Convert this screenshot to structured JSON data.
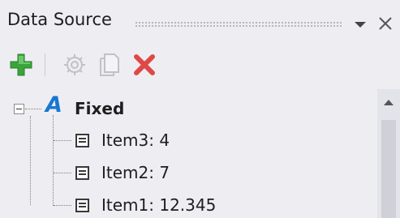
{
  "panel": {
    "title": "Data Source"
  },
  "toolbar": {
    "buttons": [
      {
        "icon": "plus-icon",
        "enabled": true,
        "color": "#3aa53a"
      },
      {
        "icon": "gear-icon",
        "enabled": false
      },
      {
        "icon": "copy-icon",
        "enabled": false
      },
      {
        "icon": "delete-icon",
        "enabled": true,
        "color": "#e04848"
      }
    ]
  },
  "tree": {
    "root": {
      "icon_glyph": "A",
      "label": "Fixed",
      "expanded": true
    },
    "items": [
      {
        "label": "Item3: 4"
      },
      {
        "label": "Item2: 7"
      },
      {
        "label": "Item1: 12.345"
      }
    ]
  },
  "colors": {
    "background": "#eeeef2",
    "accent": "#1976d2"
  }
}
